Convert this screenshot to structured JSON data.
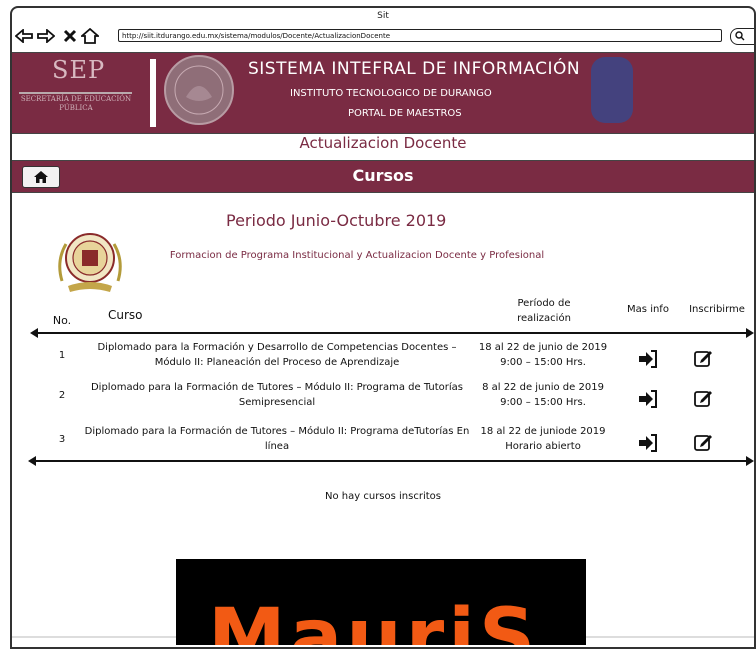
{
  "window": {
    "title": "Sit"
  },
  "browser": {
    "url": "http://siit.itdurango.edu.mx/sistema/modulos/Docente/ActualizacionDocente"
  },
  "header": {
    "sep": "SEP",
    "sep_subtitle": "SECRETARÍA DE EDUCACIÓN PÚBLICA",
    "title": "SISTEMA INTEFRAL DE INFORMACIÓN",
    "institute": "INSTITUTO TECNOLOGICO DE DURANGO",
    "portal": "PORTAL DE MAESTROS"
  },
  "page": {
    "subtitle": "Actualizacion Docente",
    "section_title": "Cursos",
    "periodo": "Periodo Junio-Octubre 2019",
    "description": "Formacion de Programa Institucional y Actualizacion Docente y Profesional",
    "empty_message": "No hay cursos inscritos"
  },
  "table": {
    "headers": {
      "no": "No.",
      "curso": "Curso",
      "periodo": "Período de realización",
      "info": "Mas info",
      "inscribir": "Inscribirme"
    },
    "rows": [
      {
        "no": "1",
        "curso": "Diplomado para la Formación y Desarrollo de Competencias Docentes – Módulo II: Planeación del Proceso de Aprendizaje",
        "periodo": "18 al 22 de junio de 2019 9:00 – 15:00 Hrs."
      },
      {
        "no": "2",
        "curso": "Diplomado para la Formación de Tutores – Módulo II: Programa de Tutorías Semipresencial",
        "periodo": "8 al 22 de junio de 2019 9:00 – 15:00 Hrs."
      },
      {
        "no": "3",
        "curso": "Diplomado para la Formación de Tutores – Módulo II: Programa deTutorías En línea",
        "periodo": "18 al 22 de juniode 2019 Horario abierto"
      }
    ]
  },
  "overlay": {
    "text": "MauriS"
  },
  "colors": {
    "brand": "#7a2b43",
    "accent_orange": "#f25a14"
  },
  "icons": {
    "back": "back-arrow-icon",
    "forward": "forward-arrow-icon",
    "close": "close-icon",
    "home": "home-icon",
    "search": "search-icon",
    "info": "sign-in-arrow-icon",
    "enroll": "edit-icon"
  }
}
